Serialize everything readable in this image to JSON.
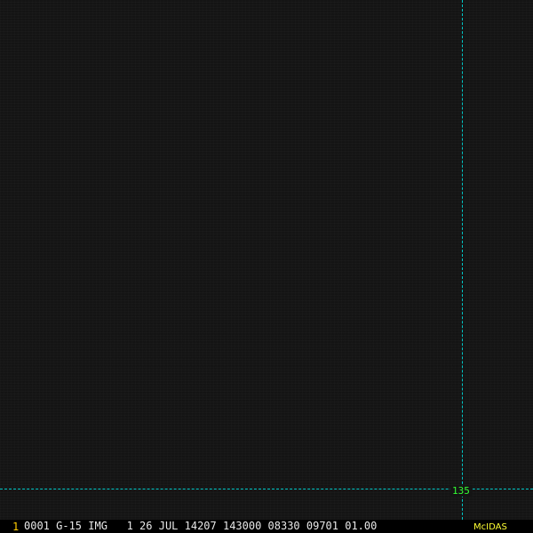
{
  "overlay": {
    "grid_label": "135",
    "grid_line_color": "#00c8c8",
    "label_color": "#33ff33"
  },
  "status_bar": {
    "frame_number": "1",
    "image_info": "0001 G-15 IMG   1 26 JUL 14207 143000 08330 09701 01.00",
    "brand": "McIDAS"
  },
  "colors": {
    "background": "#141414",
    "status_text": "#e8e8e8",
    "frame_number": "#ffcc00",
    "brand": "#ffff33"
  }
}
